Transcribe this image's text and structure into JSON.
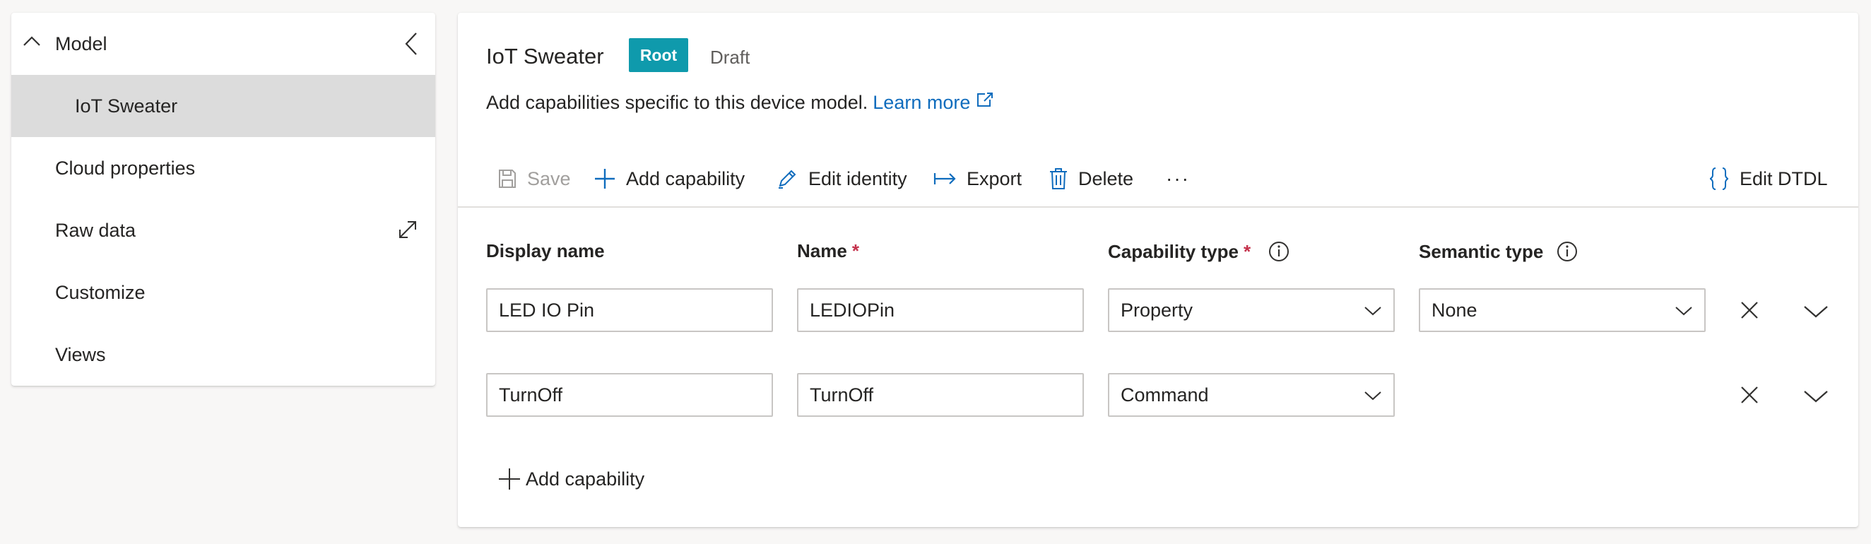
{
  "nav": {
    "model_label": "Model",
    "items": [
      {
        "label": "IoT Sweater",
        "selected": true
      },
      {
        "label": "Cloud properties"
      },
      {
        "label": "Raw data"
      },
      {
        "label": "Customize"
      },
      {
        "label": "Views"
      }
    ]
  },
  "header": {
    "title": "IoT Sweater",
    "badge": "Root",
    "status": "Draft",
    "description": "Add capabilities specific to this device model.",
    "learn_more": "Learn more"
  },
  "toolbar": {
    "save": "Save",
    "add_capability": "Add capability",
    "edit_identity": "Edit identity",
    "export": "Export",
    "delete": "Delete",
    "more": "···",
    "edit_dtdl": "Edit DTDL"
  },
  "table": {
    "headers": {
      "display_name": "Display name",
      "name": "Name",
      "capability_type": "Capability type",
      "semantic_type": "Semantic type",
      "required_marker": "*"
    },
    "rows": [
      {
        "display_name": "LED IO Pin",
        "name": "LEDIOPin",
        "capability_type": "Property",
        "semantic_type": "None"
      },
      {
        "display_name": "TurnOff",
        "name": "TurnOff",
        "capability_type": "Command"
      }
    ]
  },
  "add_capability_bottom": "Add capability",
  "colors": {
    "badge_bg": "#0f9aac",
    "link": "#0f6cbd",
    "required": "#c4314b",
    "selected_nav_bg": "#dcdcdc",
    "page_bg": "#f8f7f6"
  }
}
